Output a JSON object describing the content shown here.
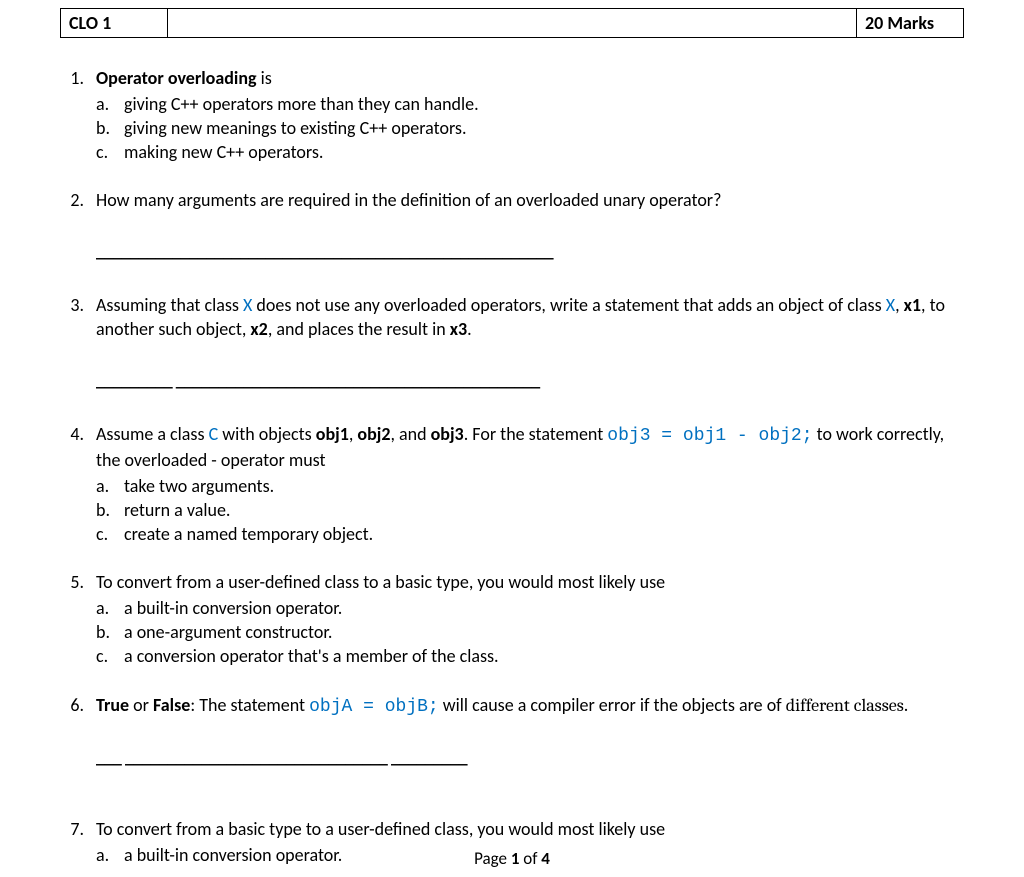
{
  "header": {
    "left": "CLO 1",
    "right": "20  Marks"
  },
  "questions": {
    "q1": {
      "num": "1.",
      "title_bold": "Operator overloading",
      "title_rest": " is",
      "opts": {
        "a": {
          "letter": "a.",
          "text": "giving C++ operators more than they can handle."
        },
        "b": {
          "letter": "b.",
          "text": "giving new meanings to existing C++ operators."
        },
        "c": {
          "letter": "c.",
          "text": "making new C++ operators."
        }
      }
    },
    "q2": {
      "num": "2.",
      "text": "How many arguments are required in the definition of an overloaded unary operator?",
      "blank": "______________________________________________________"
    },
    "q3": {
      "num": "3.",
      "seg1": "Assuming that class ",
      "classX1": "X",
      "seg2": " does not use any overloaded operators, write a statement that adds an object of class ",
      "classX2": "X",
      "seg3": ", ",
      "x1": "x1",
      "seg4": ", to another such object, ",
      "x2": "x2",
      "seg5": ", and places the result in ",
      "x3": "x3",
      "seg6": ".",
      "blank": "_________ ___________________________________________"
    },
    "q4": {
      "num": "4.",
      "seg1": "Assume a class ",
      "classC": "C",
      "seg2": " with objects ",
      "obj1": "obj1",
      "seg3": ", ",
      "obj2": "obj2",
      "seg4": ", and ",
      "obj3": "obj3",
      "seg5": ". For the statement ",
      "code": "obj3 = obj1 - obj2;",
      "seg6": " to work correctly, the overloaded - operator must",
      "opts": {
        "a": {
          "letter": "a.",
          "text": "take two arguments."
        },
        "b": {
          "letter": "b.",
          "text": "return a value."
        },
        "c": {
          "letter": "c.",
          "text": "create a named temporary object."
        }
      }
    },
    "q5": {
      "num": "5.",
      "text": "To convert from a user-defined class to a basic type, you would most likely use",
      "opts": {
        "a": {
          "letter": "a.",
          "text": "a built-in conversion operator."
        },
        "b": {
          "letter": "b.",
          "text": "a one-argument constructor."
        },
        "c": {
          "letter": "c.",
          "text": "a conversion operator that's a member of the class."
        }
      }
    },
    "q6": {
      "num": "6.",
      "true": "True",
      "or": " or ",
      "false": "False",
      "seg1": ": The statement ",
      "code": "objA = objB;",
      "seg2": " will cause a compiler error if the objects are of ",
      "diff": "different classes",
      "seg3": ".",
      "blank": "___ _______________________________ _________"
    },
    "q7": {
      "num": "7.",
      "text": "To convert from a basic type to a user-defined class, you would most likely use",
      "opts": {
        "a": {
          "letter": "a.",
          "text": "a built-in conversion operator."
        }
      }
    }
  },
  "footer": {
    "pre": "Page ",
    "cur": "1",
    "mid": " of ",
    "total": "4"
  }
}
